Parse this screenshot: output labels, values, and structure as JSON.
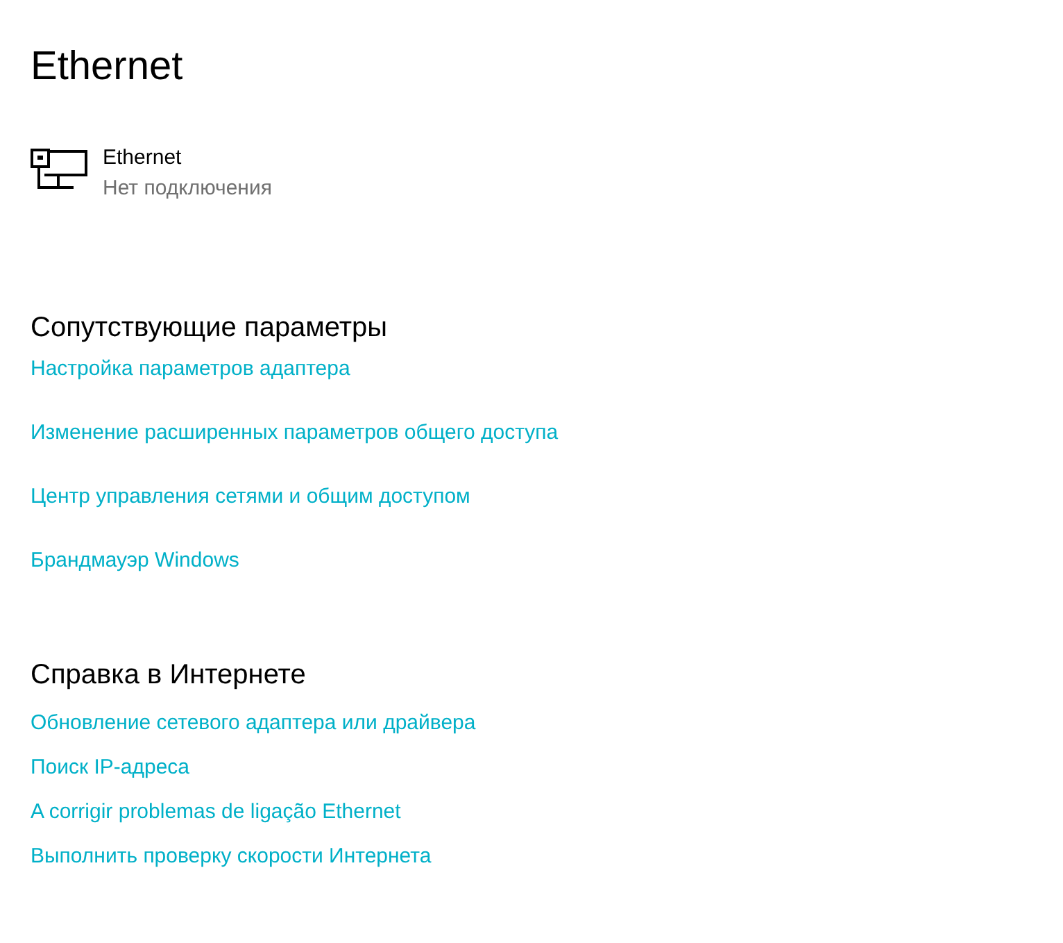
{
  "page": {
    "title": "Ethernet"
  },
  "connection": {
    "name": "Ethernet",
    "status": "Нет подключения"
  },
  "sections": [
    {
      "kind": "related",
      "title": "Сопутствующие параметры",
      "links": [
        "Настройка параметров адаптера",
        "Изменение расширенных параметров общего доступа",
        "Центр управления сетями и общим доступом",
        "Брандмауэр Windows"
      ]
    },
    {
      "kind": "help",
      "title": "Справка в Интернете",
      "links": [
        "Обновление сетевого адаптера или драйвера",
        "Поиск IP-адреса",
        "A corrigir problemas de ligação Ethernet",
        "Выполнить проверку скорости Интернета"
      ]
    }
  ]
}
